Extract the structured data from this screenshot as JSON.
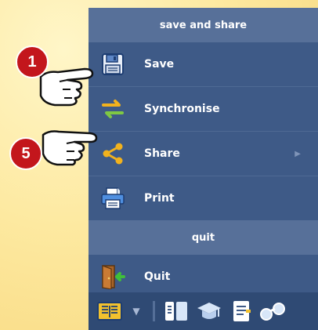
{
  "menu": {
    "sections": [
      {
        "header": "save and share",
        "items": [
          {
            "label": "Save",
            "icon": "floppy-disk-icon"
          },
          {
            "label": "Synchronise",
            "icon": "sync-arrows-icon"
          },
          {
            "label": "Share",
            "icon": "share-icon",
            "submenu": "▶"
          },
          {
            "label": "Print",
            "icon": "printer-icon"
          }
        ]
      },
      {
        "header": "quit",
        "items": [
          {
            "label": "Quit",
            "icon": "exit-door-icon"
          }
        ]
      }
    ]
  },
  "toolbar": {
    "items": [
      {
        "icon": "book-icon"
      },
      {
        "icon": "dropdown-arrow-icon",
        "glyph": "▼"
      },
      {
        "icon": "columns-icon"
      },
      {
        "icon": "graduation-cap-icon"
      },
      {
        "icon": "document-icon"
      },
      {
        "icon": "binoculars-icon"
      }
    ]
  },
  "annotations": [
    {
      "number": "1",
      "target": "Save"
    },
    {
      "number": "5",
      "target": "Share"
    }
  ],
  "colors": {
    "menu_bg": "#3e5a87",
    "header_bg": "#577099",
    "toolbar_bg": "#2f4a74",
    "badge": "#c3161c",
    "background": "#fde9a0"
  }
}
